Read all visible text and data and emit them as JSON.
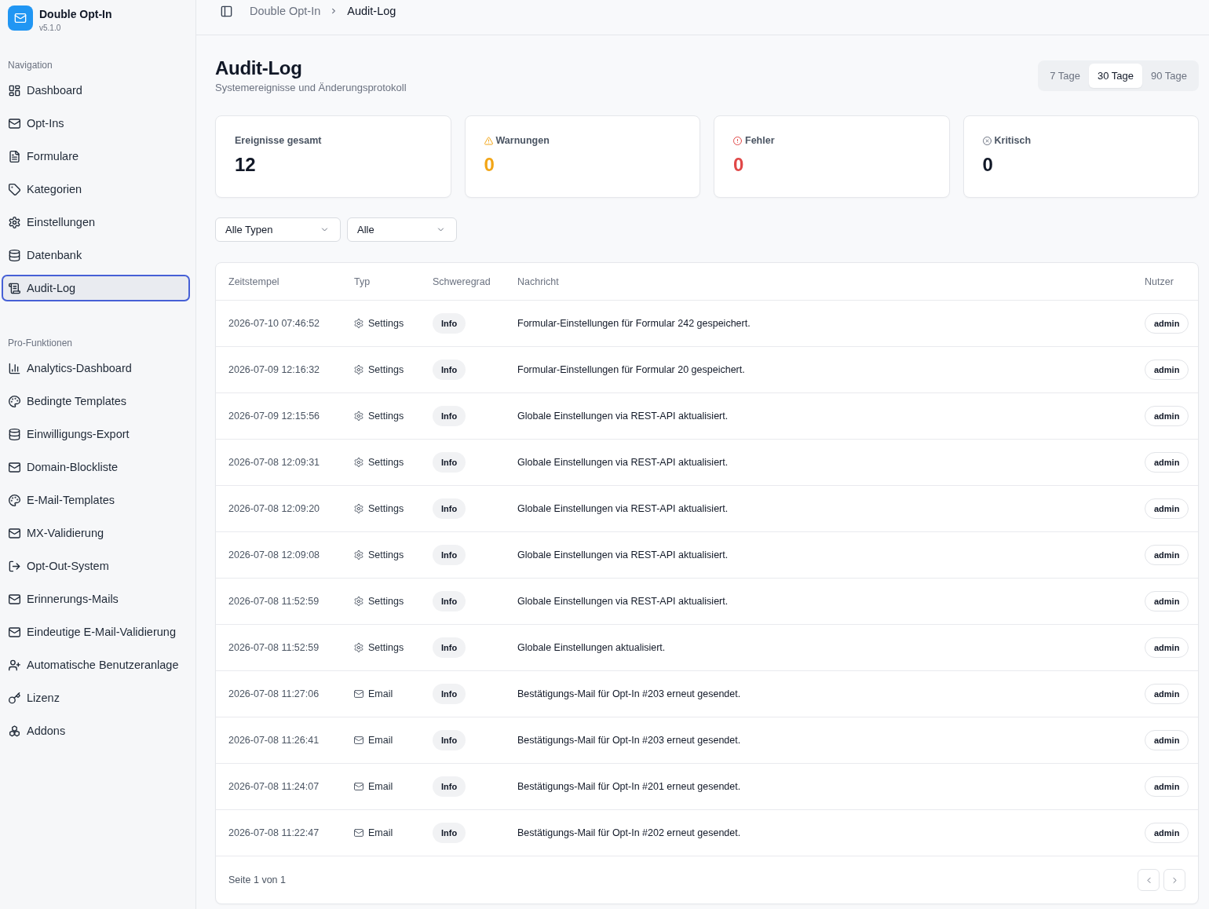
{
  "sidebar": {
    "app": {
      "title": "Double Opt-In",
      "version": "v5.1.0"
    },
    "sections": [
      {
        "heading": "Navigation",
        "items": [
          {
            "label": "Dashboard",
            "selected": false
          },
          {
            "label": "Opt-Ins",
            "selected": false
          },
          {
            "label": "Formulare",
            "selected": false
          },
          {
            "label": "Kategorien",
            "selected": false
          },
          {
            "label": "Einstellungen",
            "selected": false
          },
          {
            "label": "Datenbank",
            "selected": false
          },
          {
            "label": "Audit-Log",
            "selected": true
          }
        ]
      },
      {
        "heading": "Pro-Funktionen",
        "items": [
          {
            "label": "Analytics-Dashboard",
            "selected": false
          },
          {
            "label": "Bedingte Templates",
            "selected": false
          },
          {
            "label": "Einwilligungs-Export",
            "selected": false
          },
          {
            "label": "Domain-Blockliste",
            "selected": false
          },
          {
            "label": "E-Mail-Templates",
            "selected": false
          },
          {
            "label": "MX-Validierung",
            "selected": false
          },
          {
            "label": "Opt-Out-System",
            "selected": false
          },
          {
            "label": "Erinnerungs-Mails",
            "selected": false
          },
          {
            "label": "Eindeutige E-Mail-Validierung",
            "selected": false
          },
          {
            "label": "Automatische Benutzeranlage",
            "selected": false
          },
          {
            "label": "Lizenz",
            "selected": false
          },
          {
            "label": "Addons",
            "selected": false
          }
        ]
      }
    ]
  },
  "topbar": {
    "breadcrumb": [
      {
        "label": "Double Opt-In"
      },
      {
        "label": "Audit-Log"
      }
    ]
  },
  "page": {
    "title": "Audit-Log",
    "subtitle": "Systemereignisse und Änderungsprotokoll",
    "period_tabs": [
      {
        "label": "7 Tage",
        "selected": false
      },
      {
        "label": "30 Tage",
        "selected": true
      },
      {
        "label": "90 Tage",
        "selected": false
      }
    ]
  },
  "stats": [
    {
      "kind": "total",
      "label": "Ereignisse gesamt",
      "value": "12"
    },
    {
      "kind": "warning",
      "label": "Warnungen",
      "value": "0"
    },
    {
      "kind": "error",
      "label": "Fehler",
      "value": "0"
    },
    {
      "kind": "critical",
      "label": "Kritisch",
      "value": "0"
    }
  ],
  "filters": [
    {
      "value": "Alle Typen"
    },
    {
      "value": "Alle"
    }
  ],
  "table": {
    "columns": [
      "Zeitstempel",
      "Typ",
      "Schweregrad",
      "Nachricht",
      "Nutzer"
    ],
    "rows": [
      {
        "timestamp": "2026-07-10 07:46:52",
        "kind": "settings",
        "type": "Settings",
        "severity": "Info",
        "message": "Formular-Einstellungen für Formular 242 gespeichert.",
        "user": "admin"
      },
      {
        "timestamp": "2026-07-09 12:16:32",
        "kind": "settings",
        "type": "Settings",
        "severity": "Info",
        "message": "Formular-Einstellungen für Formular 20 gespeichert.",
        "user": "admin"
      },
      {
        "timestamp": "2026-07-09 12:15:56",
        "kind": "settings",
        "type": "Settings",
        "severity": "Info",
        "message": "Globale Einstellungen via REST-API aktualisiert.",
        "user": "admin"
      },
      {
        "timestamp": "2026-07-08 12:09:31",
        "kind": "settings",
        "type": "Settings",
        "severity": "Info",
        "message": "Globale Einstellungen via REST-API aktualisiert.",
        "user": "admin"
      },
      {
        "timestamp": "2026-07-08 12:09:20",
        "kind": "settings",
        "type": "Settings",
        "severity": "Info",
        "message": "Globale Einstellungen via REST-API aktualisiert.",
        "user": "admin"
      },
      {
        "timestamp": "2026-07-08 12:09:08",
        "kind": "settings",
        "type": "Settings",
        "severity": "Info",
        "message": "Globale Einstellungen via REST-API aktualisiert.",
        "user": "admin"
      },
      {
        "timestamp": "2026-07-08 11:52:59",
        "kind": "settings",
        "type": "Settings",
        "severity": "Info",
        "message": "Globale Einstellungen via REST-API aktualisiert.",
        "user": "admin"
      },
      {
        "timestamp": "2026-07-08 11:52:59",
        "kind": "settings",
        "type": "Settings",
        "severity": "Info",
        "message": "Globale Einstellungen aktualisiert.",
        "user": "admin"
      },
      {
        "timestamp": "2026-07-08 11:27:06",
        "kind": "email",
        "type": "Email",
        "severity": "Info",
        "message": "Bestätigungs-Mail für Opt-In #203 erneut gesendet.",
        "user": "admin"
      },
      {
        "timestamp": "2026-07-08 11:26:41",
        "kind": "email",
        "type": "Email",
        "severity": "Info",
        "message": "Bestätigungs-Mail für Opt-In #203 erneut gesendet.",
        "user": "admin"
      },
      {
        "timestamp": "2026-07-08 11:24:07",
        "kind": "email",
        "type": "Email",
        "severity": "Info",
        "message": "Bestätigungs-Mail für Opt-In #201 erneut gesendet.",
        "user": "admin"
      },
      {
        "timestamp": "2026-07-08 11:22:47",
        "kind": "email",
        "type": "Email",
        "severity": "Info",
        "message": "Bestätigungs-Mail für Opt-In #202 erneut gesendet.",
        "user": "admin"
      }
    ],
    "footer": "Seite 1 von 1"
  }
}
